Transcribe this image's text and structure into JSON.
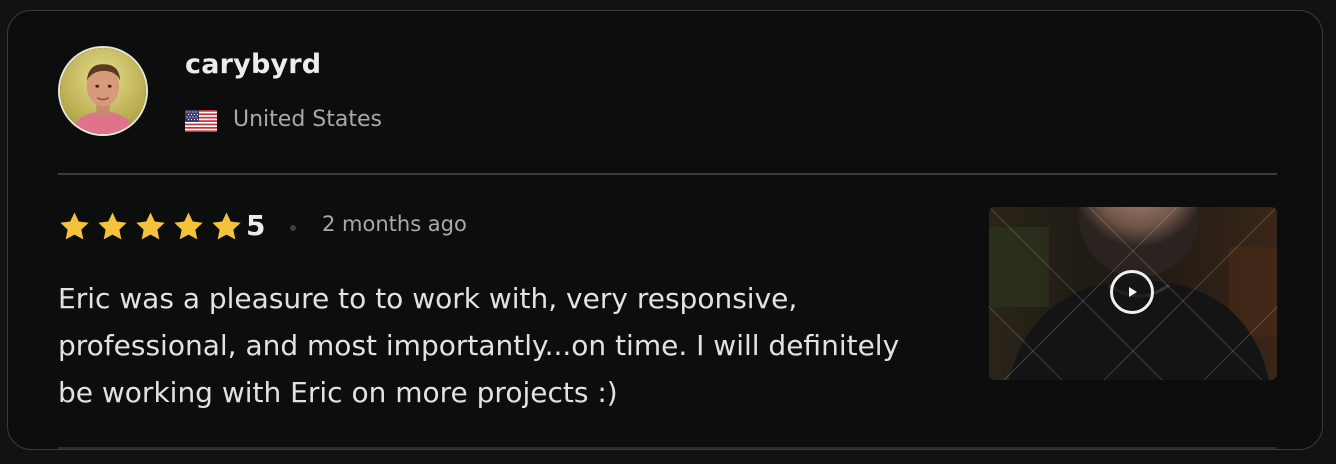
{
  "reviewer": {
    "username": "carybyrd",
    "country": "United States",
    "avatar_icon": "profile-photo",
    "flag_icon": "us-flag-icon"
  },
  "review": {
    "stars": 5,
    "rating_label": "5",
    "time_ago": "2 months ago",
    "text": "Eric was a pleasure to to work with, very responsive, professional, and most importantly...on time. I will definitely be working with Eric on more projects :)"
  },
  "video": {
    "play_icon": "play-icon",
    "watermark_icon": "fiverr-watermark"
  },
  "colors": {
    "background": "#0c0d0d",
    "star": "#f5c33b",
    "text_primary": "#e2e2e2",
    "text_secondary": "#a9a9a9",
    "border": "#3a3b3b"
  }
}
